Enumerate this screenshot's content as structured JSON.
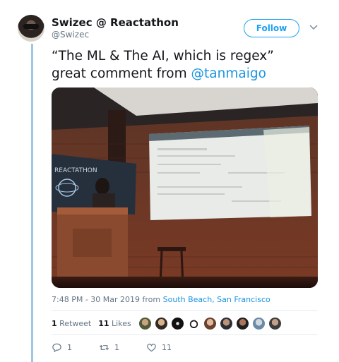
{
  "user": {
    "display_name": "Swizec @ Reactathon",
    "handle": "@Swizec",
    "follow_label": "Follow"
  },
  "tweet": {
    "text_line1": "“The ML & The AI, which is regex”",
    "text_line2_prefix": "great comment from ",
    "mention": "@tanmaigo",
    "time": "7:48 PM - 30 Mar 2019 from ",
    "location": "South Beach, San Francisco"
  },
  "stats": {
    "retweets_count": "1",
    "retweets_label": "Retweet",
    "likes_count": "11",
    "likes_label": "Likes"
  },
  "actions": {
    "reply_count": "1",
    "retweet_count": "1",
    "like_count": "11"
  },
  "photo": {
    "banner_text": "REACTATHON"
  },
  "colors": {
    "accent": "#1da1f2",
    "link": "#1b95e0",
    "thread_line": "#9fc7e3",
    "muted": "#657786"
  },
  "icons": [
    "chevron-down-icon",
    "reply-icon",
    "retweet-icon",
    "heart-icon"
  ]
}
